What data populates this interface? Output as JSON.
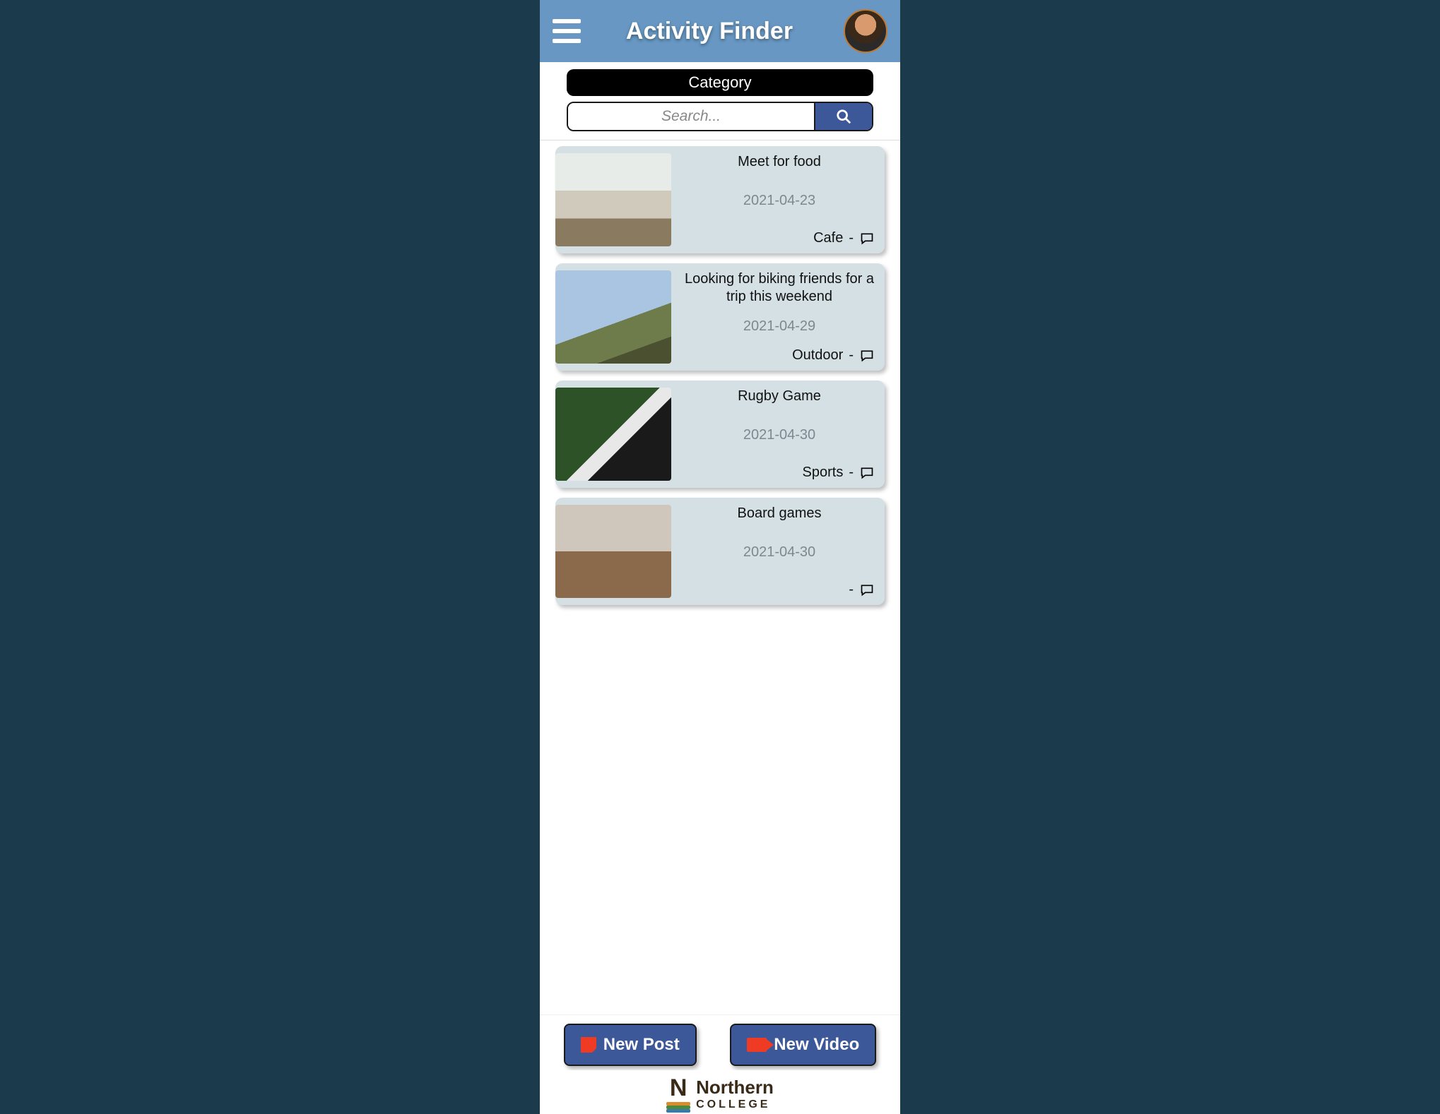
{
  "header": {
    "title": "Activity Finder"
  },
  "filter": {
    "category_label": "Category",
    "search_placeholder": "Search..."
  },
  "posts": [
    {
      "title": "Meet for food",
      "date": "2021-04-23",
      "category": "Cafe",
      "image": "cafe"
    },
    {
      "title": "Looking for biking friends for a trip this weekend",
      "date": "2021-04-29",
      "category": "Outdoor",
      "image": "hike"
    },
    {
      "title": "Rugby Game",
      "date": "2021-04-30",
      "category": "Sports",
      "image": "rugby"
    },
    {
      "title": "Board games",
      "date": "2021-04-30",
      "category": "",
      "image": "board"
    }
  ],
  "actions": {
    "new_post": "New Post",
    "new_video": "New Video"
  },
  "footer": {
    "line1": "Northern",
    "line2": "COLLEGE"
  }
}
